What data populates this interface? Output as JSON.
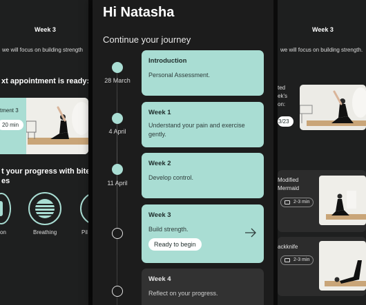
{
  "left_phone": {
    "week_label": "Week 3",
    "subtitle": "we will focus on building strength",
    "appointment_heading": "xt appointment is ready:",
    "appointment_card_title": "tment 3",
    "appointment_duration": "20 min",
    "progress_heading_line1": "t your progress with bite-siz",
    "progress_heading_line2": "es",
    "categories": [
      {
        "label": "on",
        "icon": "pose-icon"
      },
      {
        "label": "Breathing",
        "icon": "breathing-icon"
      },
      {
        "label": "Pil",
        "icon": "pilates-icon"
      }
    ]
  },
  "center_phone": {
    "greeting": "Hi Natasha",
    "section_title": "Continue your journey",
    "timeline": [
      {
        "date": "28 March",
        "title": "Introduction",
        "description": "Personal Assessment.",
        "state": "done"
      },
      {
        "date": "4 April",
        "title": "Week 1",
        "description": "Understand your pain and exercise gently.",
        "state": "done"
      },
      {
        "date": "11 April",
        "title": "Week 2",
        "description": "Develop control.",
        "state": "done"
      },
      {
        "date": "",
        "title": "Week 3",
        "description": "Build strength.",
        "state": "current",
        "badge": "Ready to begin"
      },
      {
        "date": "",
        "title": "Week 4",
        "description": "Reflect on your progress.",
        "state": "locked"
      }
    ]
  },
  "right_phone": {
    "week_label": "Week 3",
    "subtitle": "we will focus on building strength.",
    "appointment_lines": [
      "ted",
      "ek's",
      "on:",
      "3/23"
    ],
    "exercises": [
      {
        "name_line1": "Modified",
        "name_line2": "Mermaid",
        "duration": "2-3 min"
      },
      {
        "name_line1": "ackknife",
        "name_line2": "",
        "duration": "2-3 min"
      }
    ]
  },
  "colors": {
    "accent_mint": "#a9ddd3",
    "background": "#1c1c1c",
    "card_grey": "#323232"
  }
}
